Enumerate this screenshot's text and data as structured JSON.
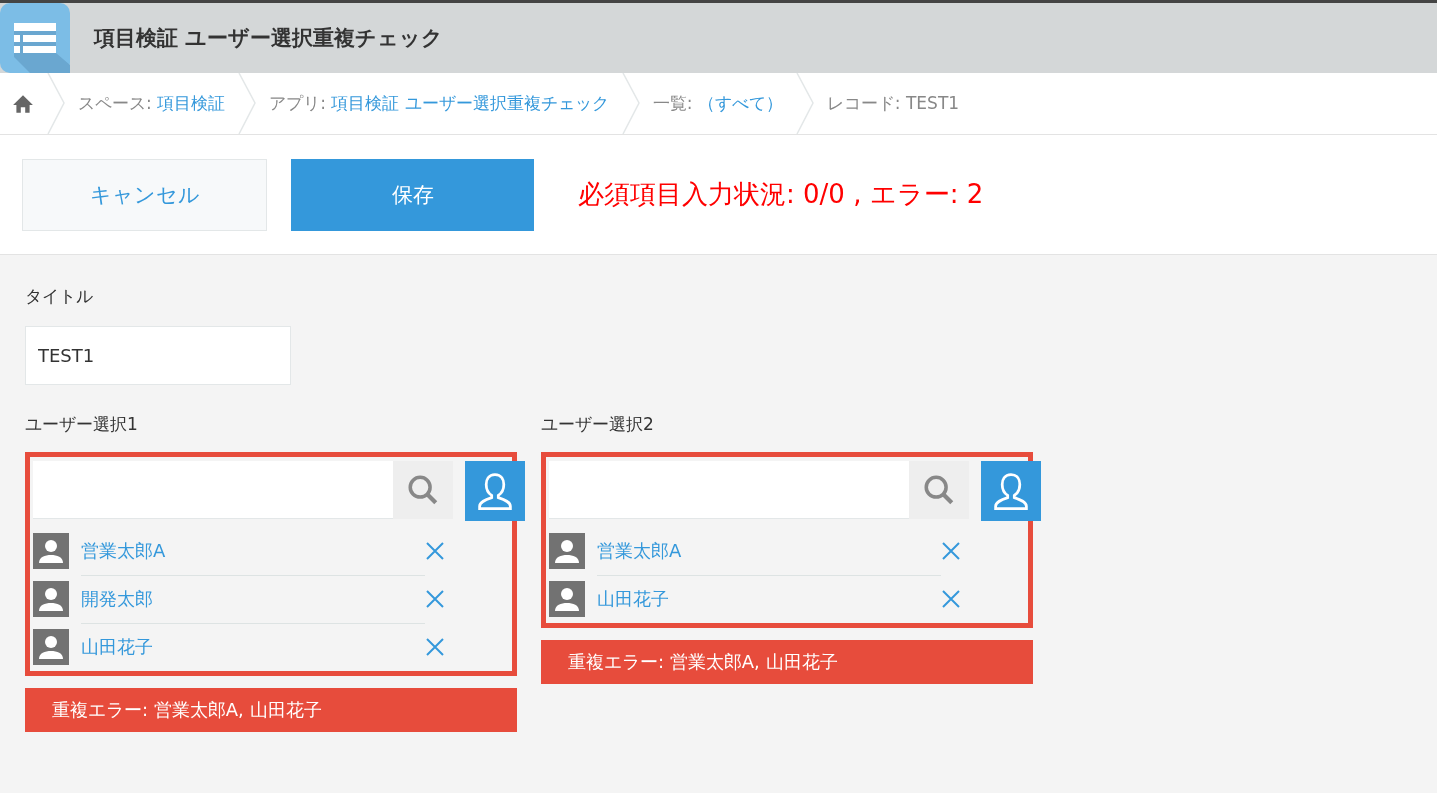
{
  "app": {
    "title": "項目検証 ユーザー選択重複チェック"
  },
  "breadcrumb": [
    {
      "label": "スペース: ",
      "link": "項目検証"
    },
    {
      "label": "アプリ: ",
      "link": "項目検証 ユーザー選択重複チェック"
    },
    {
      "label": "一覧: ",
      "link": "（すべて）"
    },
    {
      "label": "レコード: TEST1"
    }
  ],
  "actions": {
    "cancel": "キャンセル",
    "save": "保存",
    "status": "必須項目入力状況: 0/0 , エラー: 2"
  },
  "title_field": {
    "label": "タイトル",
    "value": "TEST1"
  },
  "user_fields": [
    {
      "label": "ユーザー選択1",
      "error": true,
      "users": [
        "営業太郎A",
        "開発太郎",
        "山田花子"
      ],
      "error_message": "重複エラー: 営業太郎A, 山田花子"
    },
    {
      "label": "ユーザー選択2",
      "error": true,
      "users": [
        "営業太郎A",
        "山田花子"
      ],
      "error_message": "重複エラー: 営業太郎A, 山田花子"
    }
  ]
}
